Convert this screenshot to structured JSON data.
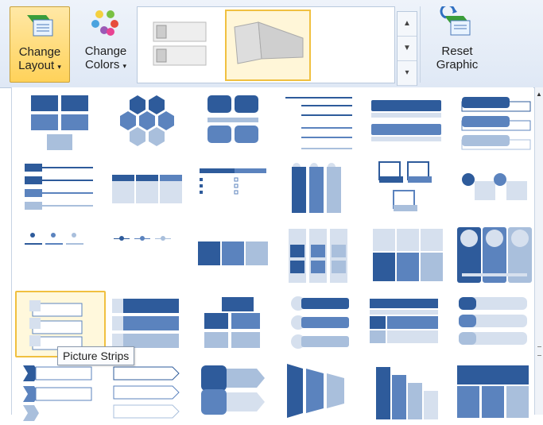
{
  "ribbon": {
    "change_layout": {
      "line1": "Change",
      "line2": "Layout",
      "caret": "▾"
    },
    "change_colors": {
      "line1": "Change",
      "line2": "Colors",
      "caret": "▾"
    },
    "reset": {
      "line1": "Reset",
      "line2": "Graphic"
    }
  },
  "tooltip": "Picture Strips",
  "colors": {
    "accent": "#f0c040",
    "dark_blue": "#2e5b9b",
    "mid_blue": "#5b83be",
    "light_blue": "#a9bfdc"
  },
  "layouts": [
    "block-grid",
    "hexagon-cluster",
    "rounded-blocks",
    "line-list",
    "stacked-bars",
    "tabbed-bars",
    "bullet-lines",
    "table-list",
    "dot-list",
    "vertical-columns",
    "picture-frames",
    "circle-accents",
    "arrow-timeline",
    "pin-timeline",
    "horizontal-blocks",
    "grid-columns",
    "image-panels",
    "circle-picture-columns",
    "picture-strips",
    "stacked-tabs",
    "offset-blocks",
    "circle-bars",
    "banded-list",
    "rounded-tabs",
    "chevron-list",
    "arrow-tabs",
    "block-arrow",
    "trapezoid-list",
    "staircase-bars",
    "segmented-block"
  ]
}
